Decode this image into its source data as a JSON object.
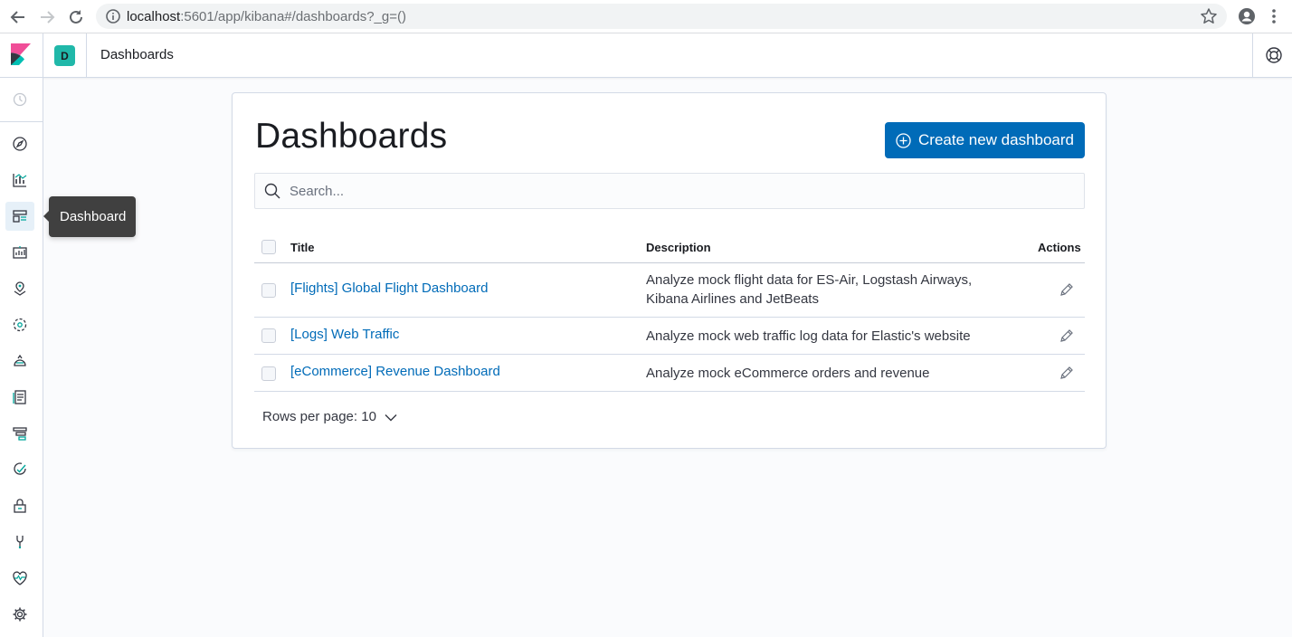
{
  "browser": {
    "url_host": "localhost",
    "url_rest": ":5601/app/kibana#/dashboards?_g=()"
  },
  "header": {
    "space_initial": "D",
    "breadcrumb": "Dashboards"
  },
  "side_nav": {
    "tooltip": "Dashboard",
    "items": [
      {
        "icon": "clock-icon"
      },
      {
        "icon": "discover-icon"
      },
      {
        "icon": "visualize-icon"
      },
      {
        "icon": "dashboard-icon",
        "active": true
      },
      {
        "icon": "canvas-icon"
      },
      {
        "icon": "maps-icon"
      },
      {
        "icon": "ml-icon"
      },
      {
        "icon": "infrastructure-icon"
      },
      {
        "icon": "logs-icon"
      },
      {
        "icon": "apm-icon"
      },
      {
        "icon": "uptime-icon"
      },
      {
        "icon": "siem-icon"
      },
      {
        "icon": "dev-tools-icon"
      },
      {
        "icon": "monitoring-icon"
      },
      {
        "icon": "management-icon"
      }
    ]
  },
  "main": {
    "title": "Dashboards",
    "create_button": "Create new dashboard",
    "search_placeholder": "Search...",
    "columns": {
      "title": "Title",
      "description": "Description",
      "actions": "Actions"
    },
    "rows": [
      {
        "title": "[Flights] Global Flight Dashboard",
        "description": "Analyze mock flight data for ES-Air, Logstash Airways, Kibana Airlines and JetBeats"
      },
      {
        "title": "[Logs] Web Traffic",
        "description": "Analyze mock web traffic log data for Elastic's website"
      },
      {
        "title": "[eCommerce] Revenue Dashboard",
        "description": "Analyze mock eCommerce orders and revenue"
      }
    ],
    "rows_per_page": "Rows per page: 10"
  },
  "colors": {
    "primary": "#006bb8",
    "space_avatar": "#20b8a9",
    "tooltip_bg": "#404040"
  }
}
